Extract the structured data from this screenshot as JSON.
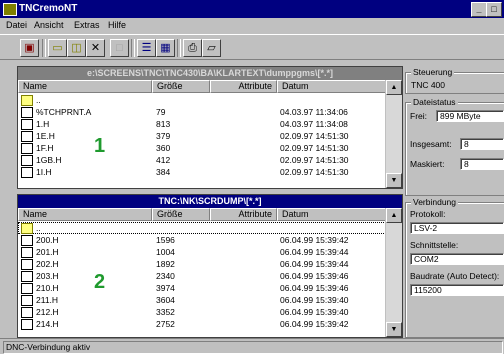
{
  "window": {
    "title": "TNCremoNT",
    "controls": [
      "_",
      "□",
      "×"
    ]
  },
  "menu": [
    "Datei",
    "Ansicht",
    "Extras",
    "Hilfe"
  ],
  "toolbar": {
    "icons": [
      "disk-icon",
      "folder-icon",
      "open-folder-icon",
      "delete-icon",
      "blank-icon",
      "list-view-icon",
      "detail-view-icon",
      "transfer-icon",
      "edit-icon"
    ]
  },
  "pane1": {
    "title": "e:\\SCREENS\\TNC\\TNC430\\BA\\KLARTEXT\\dumppgms\\[*.*]",
    "columns": [
      "Name",
      "Größe",
      "Attribute",
      "Datum"
    ],
    "marker": "1",
    "rows": [
      {
        "name": "..",
        "size": "",
        "attr": "",
        "date": "",
        "type": "folder"
      },
      {
        "name": "%TCHPRNT.A",
        "size": "79",
        "attr": "",
        "date": "04.03.97 11:34:06",
        "type": "file"
      },
      {
        "name": "1.H",
        "size": "813",
        "attr": "",
        "date": "04.03.97 11:34:08",
        "type": "file"
      },
      {
        "name": "1E.H",
        "size": "379",
        "attr": "",
        "date": "02.09.97 14:51:30",
        "type": "file"
      },
      {
        "name": "1F.H",
        "size": "360",
        "attr": "",
        "date": "02.09.97 14:51:30",
        "type": "file"
      },
      {
        "name": "1GB.H",
        "size": "412",
        "attr": "",
        "date": "02.09.97 14:51:30",
        "type": "file"
      },
      {
        "name": "1I.H",
        "size": "384",
        "attr": "",
        "date": "02.09.97 14:51:30",
        "type": "file"
      }
    ]
  },
  "pane2": {
    "title": "TNC:\\NK\\SCRDUMP\\[*.*]",
    "columns": [
      "Name",
      "Größe",
      "Attribute",
      "Datum"
    ],
    "marker": "2",
    "rows": [
      {
        "name": "..",
        "size": "",
        "attr": "",
        "date": "",
        "type": "folder"
      },
      {
        "name": "200.H",
        "size": "1596",
        "attr": "",
        "date": "06.04.99 15:39:42",
        "type": "file"
      },
      {
        "name": "201.H",
        "size": "1004",
        "attr": "",
        "date": "06.04.99 15:39:44",
        "type": "file"
      },
      {
        "name": "202.H",
        "size": "1892",
        "attr": "",
        "date": "06.04.99 15:39:44",
        "type": "file"
      },
      {
        "name": "203.H",
        "size": "2340",
        "attr": "",
        "date": "06.04.99 15:39:46",
        "type": "file"
      },
      {
        "name": "210.H",
        "size": "3974",
        "attr": "",
        "date": "06.04.99 15:39:46",
        "type": "file"
      },
      {
        "name": "211.H",
        "size": "3604",
        "attr": "",
        "date": "06.04.99 15:39:40",
        "type": "file"
      },
      {
        "name": "212.H",
        "size": "3352",
        "attr": "",
        "date": "06.04.99 15:39:40",
        "type": "file"
      },
      {
        "name": "214.H",
        "size": "2752",
        "attr": "",
        "date": "06.04.99 15:39:42",
        "type": "file"
      }
    ]
  },
  "control": {
    "label": "Steuerung",
    "value": "TNC 400"
  },
  "file_status": {
    "label": "Dateistatus",
    "free_label": "Frei:",
    "free_value": "899 MByte",
    "total_label": "Insgesamt:",
    "total_value": "8",
    "marked_label": "Maskiert:",
    "marked_value": "8"
  },
  "connection": {
    "label": "Verbindung",
    "protocol_label": "Protokoll:",
    "protocol_value": "LSV-2",
    "interface_label": "Schnittstelle:",
    "interface_value": "COM2",
    "baud_label": "Baudrate (Auto Detect):",
    "baud_value": "115200"
  },
  "status": "DNC-Verbindung aktiv"
}
